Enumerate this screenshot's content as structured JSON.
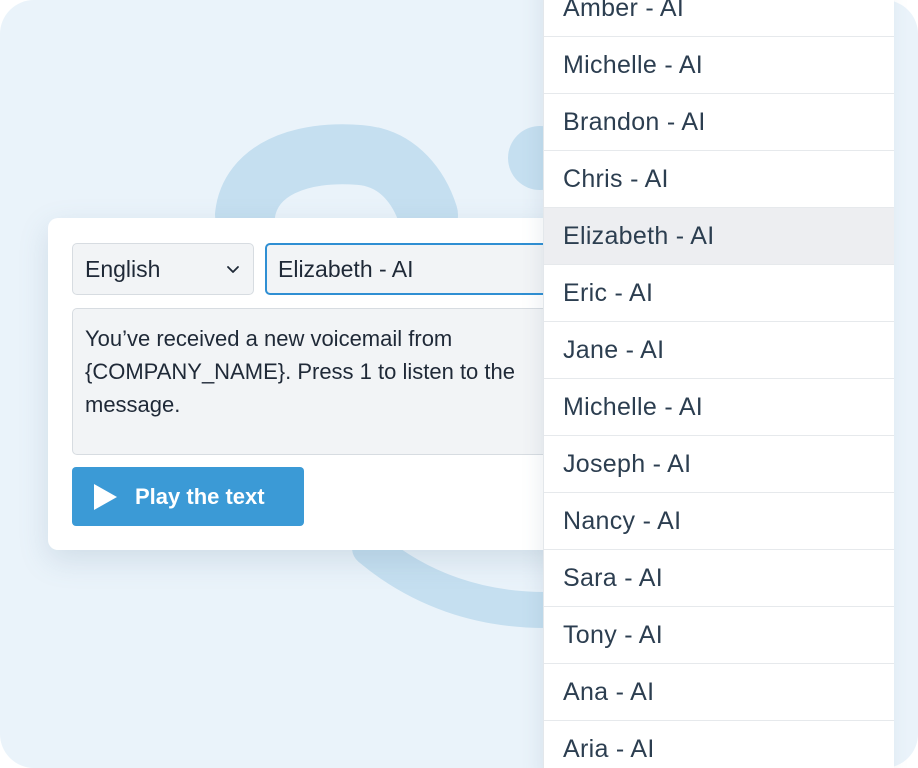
{
  "language_select": {
    "value": "English",
    "icon": "chevron-down-icon"
  },
  "voice_select": {
    "value": "Elizabeth - AI"
  },
  "message": {
    "text": "You’ve received a new voicemail from {COMPANY_NAME}. Press 1 to listen to the message."
  },
  "play_button": {
    "label": "Play the text",
    "icon": "play-icon"
  },
  "voice_options": [
    "Amber - AI",
    "Michelle - AI",
    "Brandon - AI",
    "Chris - AI",
    "Elizabeth - AI",
    "Eric - AI",
    "Jane - AI",
    "Michelle - AI",
    "Joseph - AI",
    "Nancy - AI",
    "Sara - AI",
    "Tony - AI",
    "Ana - AI",
    "Aria - AI"
  ],
  "selected_voice_index": 4,
  "colors": {
    "background": "#eaf3fa",
    "decoration": "#c5dff0",
    "accent": "#3b9ad6",
    "focus_border": "#2f8fd3",
    "selected_option": "#edeef1"
  }
}
